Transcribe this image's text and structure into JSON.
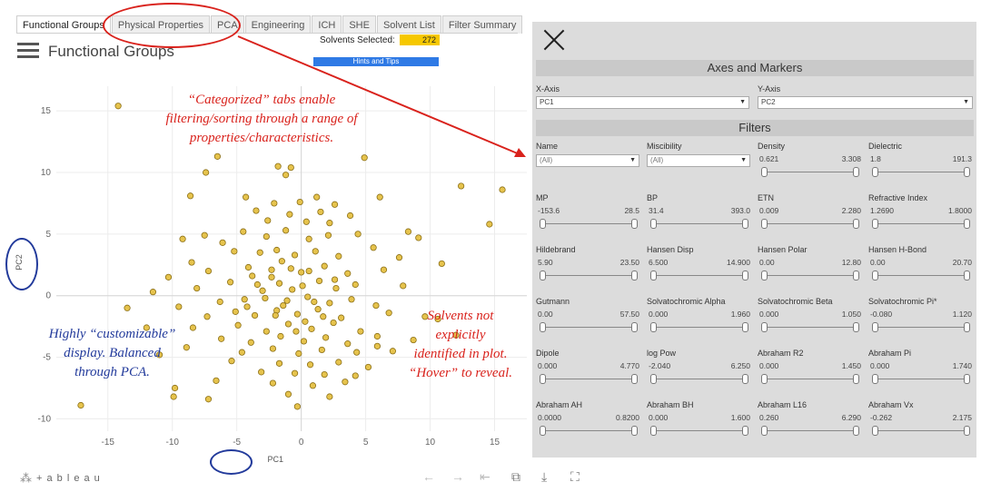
{
  "tabs": [
    "Functional Groups",
    "Physical Properties",
    "PCA",
    "Engineering",
    "ICH",
    "SHE",
    "Solvent List",
    "Filter Summary"
  ],
  "header": {
    "solvents_selected_label": "Solvents Selected:",
    "solvents_selected_count": "272",
    "hints_button": "Hints and Tips",
    "page_title": "Functional Groups"
  },
  "annotations": {
    "categorized": [
      "“Categorized” tabs enable",
      "filtering/sorting through a range of",
      "properties/characteristics."
    ],
    "customizable": [
      "Highly “customizable”",
      "display. Balanced",
      "through PCA."
    ],
    "solvents": [
      "Solvents not",
      "explicitly",
      "identified in plot.",
      "“Hover” to reveal."
    ]
  },
  "colors": {
    "point_fill": "#e6c34d",
    "point_stroke": "#8b6f16",
    "red": "#d9221c",
    "blue": "#223a9b",
    "selected_bar": "#f6c800",
    "hints_bar": "#2f7ae5"
  },
  "chart_data": {
    "type": "scatter",
    "xlabel": "PC1",
    "ylabel": "PC2",
    "xlim": [
      -19,
      17.5
    ],
    "ylim": [
      -11,
      17
    ],
    "xticks": [
      -15,
      -10,
      -5,
      0,
      5,
      10,
      15
    ],
    "yticks": [
      -10,
      -5,
      0,
      5,
      10,
      15
    ],
    "points": [
      [
        -14.2,
        15.4
      ],
      [
        -6.5,
        11.3
      ],
      [
        -1.8,
        10.5
      ],
      [
        -0.8,
        10.4
      ],
      [
        -1.2,
        9.8
      ],
      [
        4.9,
        11.2
      ],
      [
        15.6,
        8.6
      ],
      [
        12.4,
        8.9
      ],
      [
        -7.4,
        10.0
      ],
      [
        -8.6,
        8.1
      ],
      [
        -4.3,
        8.0
      ],
      [
        1.2,
        8.0
      ],
      [
        6.1,
        8.0
      ],
      [
        -2.1,
        7.5
      ],
      [
        -0.1,
        7.6
      ],
      [
        2.6,
        7.4
      ],
      [
        14.6,
        5.8
      ],
      [
        -3.5,
        6.9
      ],
      [
        -0.9,
        6.6
      ],
      [
        1.5,
        6.8
      ],
      [
        3.8,
        6.5
      ],
      [
        -2.6,
        6.1
      ],
      [
        0.4,
        6.0
      ],
      [
        2.2,
        5.9
      ],
      [
        -9.2,
        4.6
      ],
      [
        -7.5,
        4.9
      ],
      [
        -6.1,
        4.3
      ],
      [
        -4.5,
        5.2
      ],
      [
        -2.7,
        4.8
      ],
      [
        -1.2,
        5.3
      ],
      [
        0.6,
        4.6
      ],
      [
        2.1,
        4.9
      ],
      [
        4.4,
        5.0
      ],
      [
        8.3,
        5.2
      ],
      [
        9.1,
        4.7
      ],
      [
        -8.5,
        2.7
      ],
      [
        -5.2,
        3.6
      ],
      [
        -3.2,
        3.5
      ],
      [
        -1.9,
        3.7
      ],
      [
        -0.5,
        3.3
      ],
      [
        1.1,
        3.6
      ],
      [
        2.9,
        3.2
      ],
      [
        5.6,
        3.9
      ],
      [
        7.6,
        3.1
      ],
      [
        10.9,
        2.6
      ],
      [
        -10.3,
        1.5
      ],
      [
        -7.2,
        2.0
      ],
      [
        -4.1,
        2.3
      ],
      [
        -2.3,
        2.1
      ],
      [
        -0.8,
        2.2
      ],
      [
        0.6,
        2.0
      ],
      [
        1.8,
        2.4
      ],
      [
        3.6,
        1.8
      ],
      [
        6.4,
        2.1
      ],
      [
        -11.5,
        0.3
      ],
      [
        -8.1,
        0.6
      ],
      [
        -5.5,
        1.1
      ],
      [
        -3.4,
        0.9
      ],
      [
        -1.7,
        1.0
      ],
      [
        0.1,
        0.8
      ],
      [
        1.4,
        1.2
      ],
      [
        2.7,
        0.6
      ],
      [
        4.2,
        0.9
      ],
      [
        7.9,
        0.8
      ],
      [
        -9.5,
        -0.9
      ],
      [
        -6.3,
        -0.5
      ],
      [
        -4.4,
        -0.3
      ],
      [
        -2.8,
        -0.2
      ],
      [
        -1.1,
        -0.4
      ],
      [
        0.5,
        -0.1
      ],
      [
        2.2,
        -0.6
      ],
      [
        3.9,
        -0.3
      ],
      [
        5.8,
        -0.8
      ],
      [
        -7.3,
        -1.7
      ],
      [
        -5.1,
        -1.3
      ],
      [
        -3.6,
        -1.6
      ],
      [
        -1.9,
        -1.2
      ],
      [
        -0.3,
        -1.5
      ],
      [
        1.3,
        -1.1
      ],
      [
        3.1,
        -1.8
      ],
      [
        6.8,
        -1.4
      ],
      [
        9.6,
        -1.7
      ],
      [
        -8.4,
        -2.6
      ],
      [
        -4.9,
        -2.4
      ],
      [
        -2.7,
        -2.9
      ],
      [
        -1.0,
        -2.3
      ],
      [
        0.8,
        -2.7
      ],
      [
        2.5,
        -2.2
      ],
      [
        4.6,
        -2.9
      ],
      [
        10.6,
        -1.9
      ],
      [
        -6.2,
        -3.5
      ],
      [
        -3.9,
        -3.8
      ],
      [
        -1.6,
        -3.3
      ],
      [
        0.2,
        -3.7
      ],
      [
        1.9,
        -3.4
      ],
      [
        3.6,
        -3.9
      ],
      [
        5.9,
        -3.3
      ],
      [
        8.7,
        -3.6
      ],
      [
        -8.9,
        -4.2
      ],
      [
        -4.6,
        -4.6
      ],
      [
        -2.2,
        -4.3
      ],
      [
        -0.2,
        -4.7
      ],
      [
        1.6,
        -4.4
      ],
      [
        4.3,
        -4.6
      ],
      [
        7.1,
        -4.5
      ],
      [
        -5.4,
        -5.3
      ],
      [
        -1.7,
        -5.5
      ],
      [
        0.7,
        -5.6
      ],
      [
        2.9,
        -5.4
      ],
      [
        5.2,
        -5.8
      ],
      [
        -3.1,
        -6.2
      ],
      [
        -0.5,
        -6.3
      ],
      [
        1.8,
        -6.4
      ],
      [
        4.2,
        -6.5
      ],
      [
        -6.6,
        -6.9
      ],
      [
        -2.2,
        -7.1
      ],
      [
        0.9,
        -7.3
      ],
      [
        3.4,
        -7.0
      ],
      [
        -9.8,
        -7.5
      ],
      [
        -1.0,
        -8.0
      ],
      [
        2.2,
        -8.2
      ],
      [
        -9.9,
        -8.2
      ],
      [
        -7.2,
        -8.4
      ],
      [
        -17.1,
        -8.9
      ],
      [
        -0.3,
        -9.0
      ],
      [
        5.9,
        -4.1
      ],
      [
        -12.0,
        -2.6
      ],
      [
        12.0,
        -3.2
      ],
      [
        -13.5,
        -1.0
      ],
      [
        -11.0,
        -4.8
      ],
      [
        -3.0,
        0.4
      ],
      [
        -2.3,
        1.5
      ],
      [
        -1.4,
        -0.8
      ],
      [
        0.0,
        1.9
      ],
      [
        -0.7,
        0.5
      ],
      [
        1.0,
        -0.5
      ],
      [
        -2.0,
        -1.6
      ],
      [
        0.3,
        -2.1
      ],
      [
        -3.8,
        1.6
      ],
      [
        2.6,
        1.3
      ],
      [
        -1.5,
        2.8
      ],
      [
        -4.2,
        -0.9
      ],
      [
        1.7,
        -1.7
      ],
      [
        -0.4,
        -2.9
      ]
    ]
  }
}
